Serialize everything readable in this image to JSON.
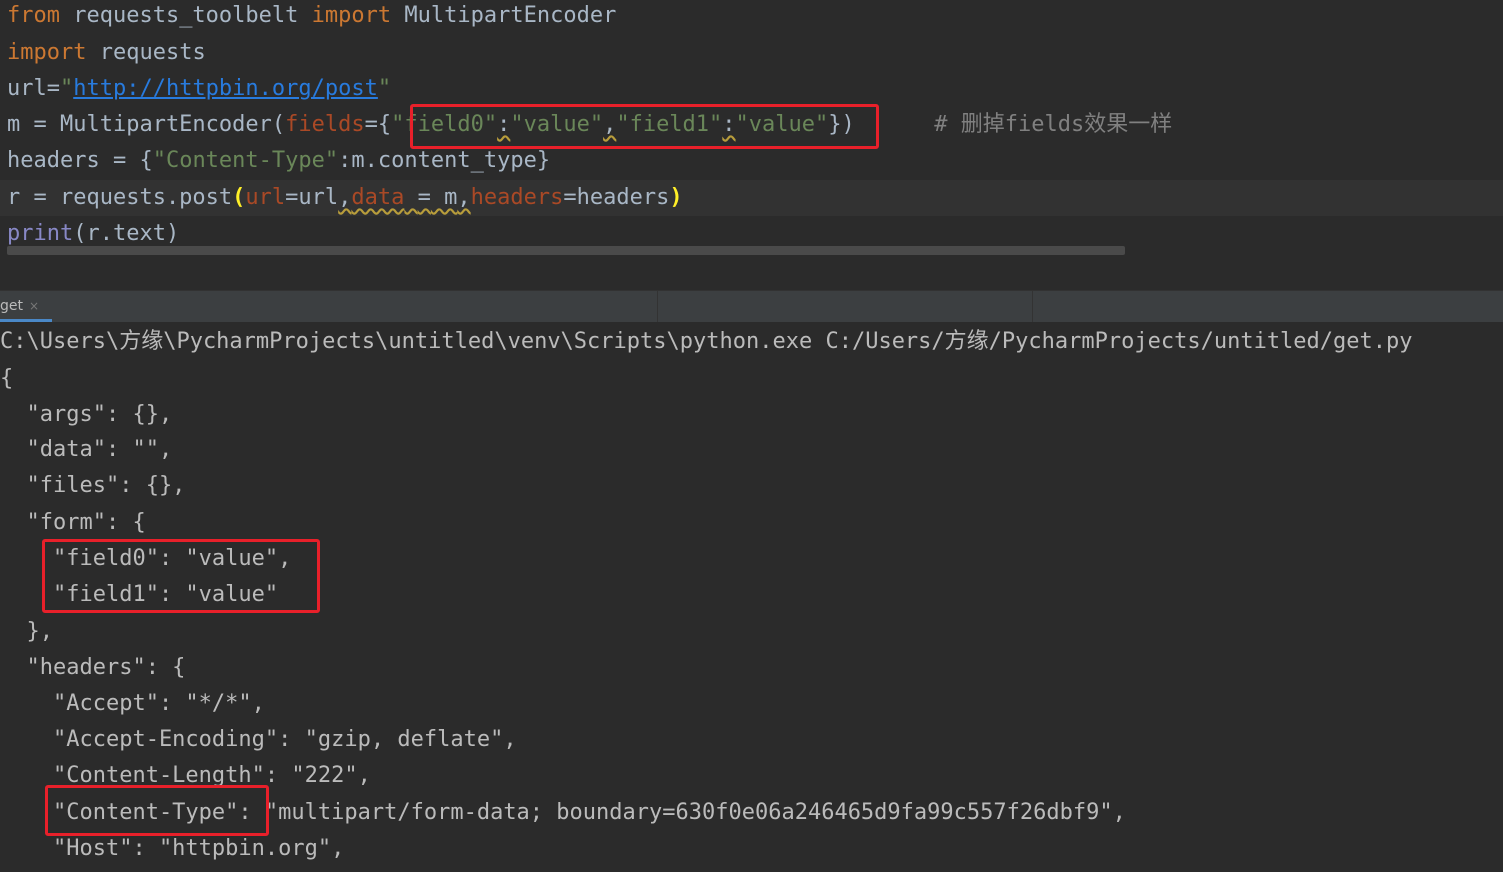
{
  "editor": {
    "l1": [
      "from",
      " requests_toolbelt ",
      "import",
      " MultipartEncoder"
    ],
    "l2": [
      "import",
      " requests"
    ],
    "l3": [
      "url=",
      "\"",
      "http://httpbin.org/post",
      "\""
    ],
    "l4": [
      "m = MultipartEncoder(",
      "fields",
      "={",
      "\"field0\"",
      ":",
      "\"value\"",
      ",",
      "\"field1\"",
      ":",
      "\"value\"",
      "})",
      "      # 删掉fields效果一样"
    ],
    "l5": [
      "headers = {",
      "\"Content-Type\"",
      ":m.content_type}"
    ],
    "l6": [
      "r = requests.post",
      "(",
      "url",
      "=url",
      ",",
      "data",
      " ",
      "=",
      " m",
      ",",
      "headers",
      "=headers",
      ")"
    ],
    "l7": [
      "print",
      "(r.text)"
    ]
  },
  "run_tab": {
    "label": "get",
    "close": "×"
  },
  "console": [
    "C:\\Users\\方缘\\PycharmProjects\\untitled\\venv\\Scripts\\python.exe C:/Users/方缘/PycharmProjects/untitled/get.py",
    "{",
    "  \"args\": {},",
    "  \"data\": \"\",",
    "  \"files\": {},",
    "  \"form\": {",
    "    \"field0\": \"value\",",
    "    \"field1\": \"value\"",
    "  },",
    "  \"headers\": {",
    "    \"Accept\": \"*/*\",",
    "    \"Accept-Encoding\": \"gzip, deflate\",",
    "    \"Content-Length\": \"222\",",
    "    \"Content-Type\": \"multipart/form-data; boundary=630f0e06a246465d9fa99c557f26dbf9\",",
    "    \"Host\": \"httpbin.org\","
  ],
  "colors": {
    "annotation": "#e8202a",
    "keyword": "#cc7832",
    "string": "#6a8759",
    "param": "#aa4926"
  }
}
